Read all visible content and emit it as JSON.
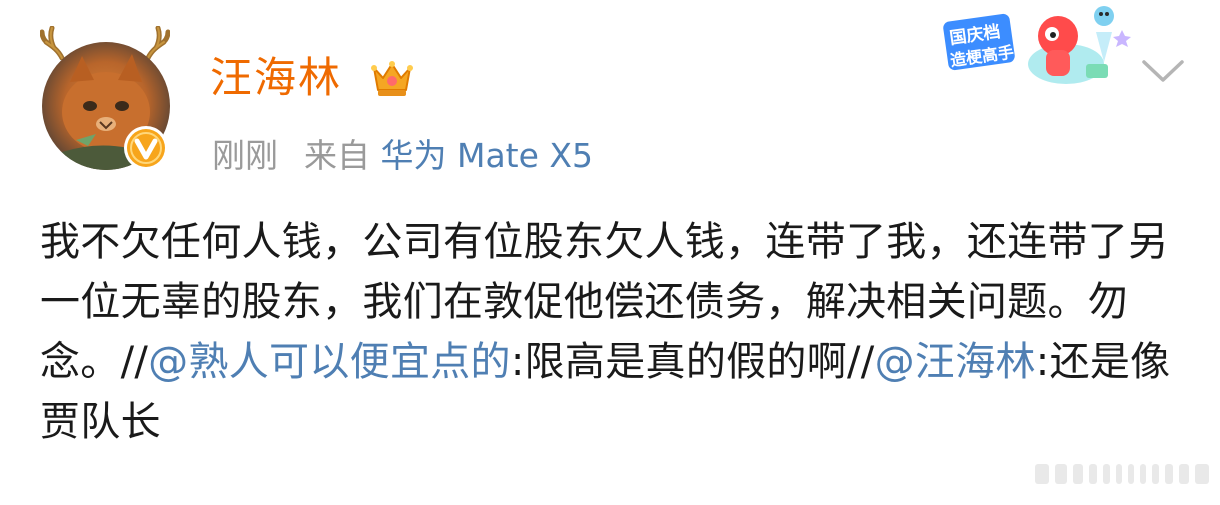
{
  "user": {
    "name": "汪海林",
    "avatar_icon": "cat-avatar",
    "verified_icon": "verified-v-icon",
    "member_icon": "crown-icon"
  },
  "meta": {
    "time": "刚刚",
    "source_prefix": "来自",
    "source_device": "华为 Mate X5"
  },
  "promo_badge": {
    "line1": "国庆档",
    "line2": "造梗高手"
  },
  "menu": {
    "icon": "chevron-down-icon"
  },
  "post": {
    "segments": [
      {
        "type": "text",
        "text": "我不欠任何人钱，公司有位股东欠人钱，连带了我，还连带了另一位无辜的股东，我们在敦促他偿还债务，解决相关问题。勿念。//"
      },
      {
        "type": "mention",
        "text": "@熟人可以便宜点的"
      },
      {
        "type": "text",
        "text": ":限高是真的假的啊//"
      },
      {
        "type": "mention",
        "text": "@汪海林"
      },
      {
        "type": "text",
        "text": ":还是像贾队长"
      }
    ]
  },
  "colors": {
    "username": "#ef6a00",
    "link": "#4f7fb3",
    "meta": "#9a9a9a",
    "body_text": "#1a1a1a"
  }
}
